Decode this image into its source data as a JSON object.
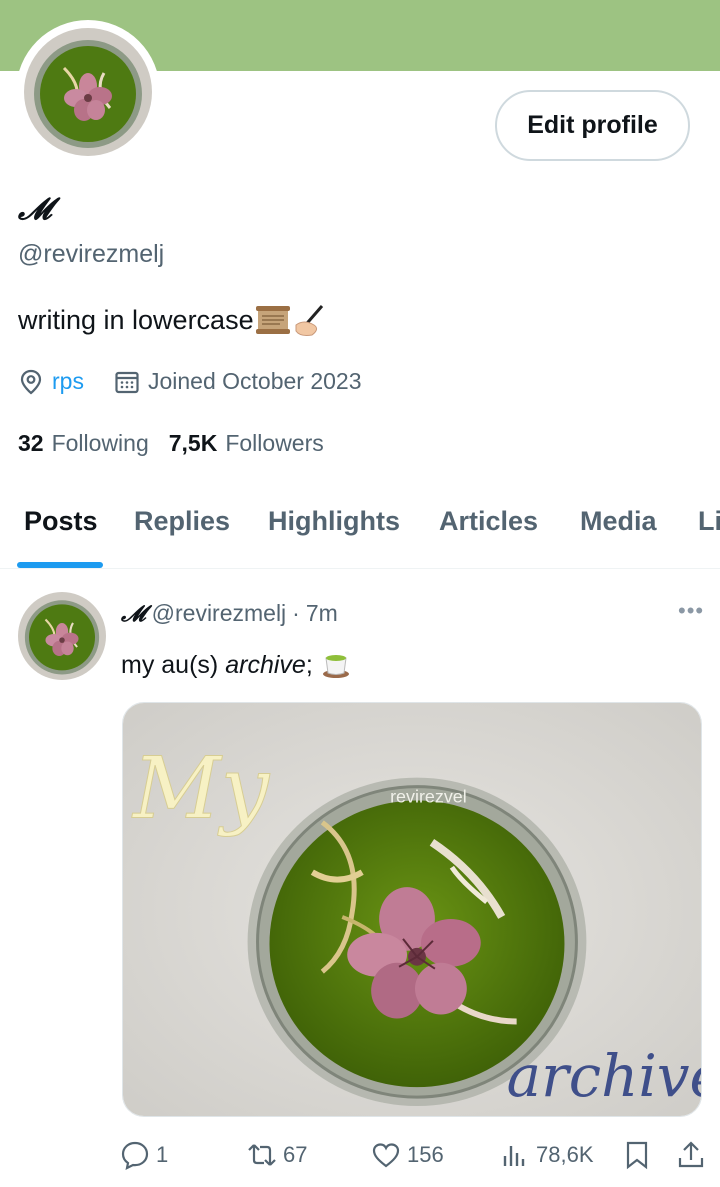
{
  "profile": {
    "display_name": "𝓜",
    "handle": "@revirezmelj",
    "bio": "writing in lowercase",
    "location": "rps",
    "joined": "Joined October 2023",
    "following_count": "32",
    "following_label": "Following",
    "followers_count": "7,5K",
    "followers_label": "Followers",
    "edit_profile_label": "Edit profile"
  },
  "tabs": [
    {
      "label": "Posts",
      "active": true
    },
    {
      "label": "Replies"
    },
    {
      "label": "Highlights"
    },
    {
      "label": "Articles"
    },
    {
      "label": "Media"
    },
    {
      "label": "Li"
    }
  ],
  "post": {
    "author_name": "𝓜",
    "author_handle": "@revirezmelj",
    "separator": "·",
    "time": "7m",
    "text_plain": "my au(s)",
    "text_italic": "archive",
    "text_suffix": " ;",
    "image_text_top": "My",
    "image_text_bottom": "archive",
    "image_watermark": "revirezvel",
    "actions": {
      "replies": "1",
      "reposts": "67",
      "likes": "156",
      "views": "78,6K"
    }
  },
  "colors": {
    "banner": "#9dc382",
    "accent": "#1d9bf0",
    "text_primary": "#0f1419",
    "text_secondary": "#536471"
  },
  "icons": [
    "location-pin-icon",
    "calendar-icon",
    "more-icon",
    "reply-icon",
    "repost-icon",
    "like-icon",
    "views-icon",
    "bookmark-icon",
    "share-icon",
    "scroll-emoji-icon",
    "writing-hand-emoji-icon",
    "tea-emoji-icon"
  ]
}
